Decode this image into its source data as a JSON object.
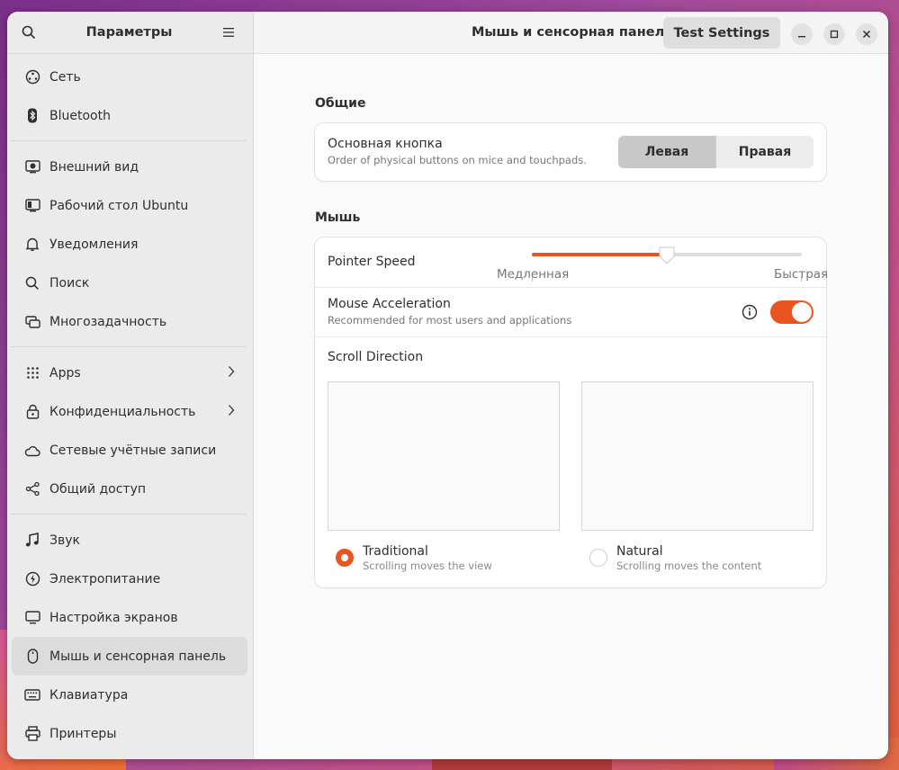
{
  "window": {
    "sidebar_title": "Параметры",
    "main_title": "Мышь и сенсорная панель",
    "test_button": "Test Settings"
  },
  "sidebar": {
    "groups": [
      [
        {
          "label": "Сеть",
          "icon": "network-icon"
        },
        {
          "label": "Bluetooth",
          "icon": "bluetooth-icon"
        }
      ],
      [
        {
          "label": "Внешний вид",
          "icon": "appearance-icon"
        },
        {
          "label": "Рабочий стол Ubuntu",
          "icon": "desktop-icon"
        },
        {
          "label": "Уведомления",
          "icon": "bell-icon"
        },
        {
          "label": "Поиск",
          "icon": "search-icon"
        },
        {
          "label": "Многозадачность",
          "icon": "multitasking-icon"
        }
      ],
      [
        {
          "label": "Apps",
          "icon": "apps-grid-icon",
          "chevron": true
        },
        {
          "label": "Конфиденциальность",
          "icon": "lock-icon",
          "chevron": true
        },
        {
          "label": "Сетевые учётные записи",
          "icon": "cloud-icon"
        },
        {
          "label": "Общий доступ",
          "icon": "share-icon"
        }
      ],
      [
        {
          "label": "Звук",
          "icon": "music-note-icon"
        },
        {
          "label": "Электропитание",
          "icon": "power-icon"
        },
        {
          "label": "Настройка экранов",
          "icon": "display-icon"
        },
        {
          "label": "Мышь и сенсорная панель",
          "icon": "mouse-icon",
          "active": true
        },
        {
          "label": "Клавиатура",
          "icon": "keyboard-icon"
        },
        {
          "label": "Принтеры",
          "icon": "printer-icon"
        }
      ]
    ]
  },
  "general": {
    "section_title": "Общие",
    "primary_button": {
      "title": "Основная кнопка",
      "subtitle": "Order of physical buttons on mice and touchpads.",
      "left": "Левая",
      "right": "Правая",
      "selected": "left"
    }
  },
  "mouse": {
    "section_title": "Мышь",
    "pointer_speed": {
      "title": "Pointer Speed",
      "min_label": "Медленная",
      "max_label": "Быстрая",
      "value": 0.5
    },
    "acceleration": {
      "title": "Mouse Acceleration",
      "subtitle": "Recommended for most users and applications",
      "enabled": true
    },
    "scroll": {
      "title": "Scroll Direction",
      "traditional": {
        "title": "Traditional",
        "subtitle": "Scrolling moves the view",
        "selected": true
      },
      "natural": {
        "title": "Natural",
        "subtitle": "Scrolling moves the content",
        "selected": false
      }
    }
  },
  "colors": {
    "accent": "#e95420"
  }
}
